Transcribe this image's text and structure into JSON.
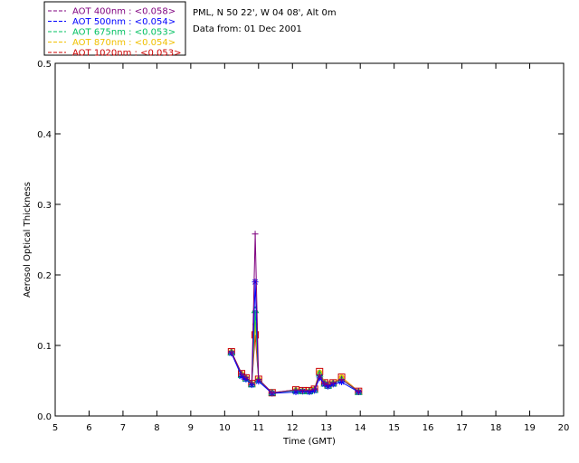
{
  "chart_data": {
    "type": "line",
    "xlabel": "Time (GMT)",
    "ylabel": "Aerosol Optical Thickness",
    "xlim": [
      5,
      20
    ],
    "ylim": [
      0.0,
      0.5
    ],
    "xticks": [
      5,
      6,
      7,
      8,
      9,
      10,
      11,
      12,
      13,
      14,
      15,
      16,
      17,
      18,
      19,
      20
    ],
    "yticks": [
      0.0,
      0.1,
      0.2,
      0.3,
      0.4,
      0.5
    ],
    "ytick_labels": [
      "0.0",
      "0.1",
      "0.2",
      "0.3",
      "0.4",
      "0.5"
    ],
    "grid": false,
    "legend_position": "top-left, outside plot",
    "info_lines": [
      "PML, N 50 22', W 04 08', Alt 0m",
      "Data from: 01 Dec 2001"
    ],
    "series": [
      {
        "name": "AOT  400nm : <0.058>",
        "color": "#7f007f",
        "marker": "plus",
        "points": [
          [
            10.2,
            0.091
          ],
          [
            10.5,
            0.06
          ],
          [
            10.63,
            0.055
          ],
          [
            10.8,
            0.047
          ],
          [
            10.9,
            0.258
          ],
          [
            11.0,
            0.052
          ],
          [
            11.4,
            0.033
          ],
          [
            12.1,
            0.037
          ],
          [
            12.3,
            0.036
          ],
          [
            12.5,
            0.036
          ],
          [
            12.65,
            0.038
          ],
          [
            12.8,
            0.058
          ],
          [
            12.95,
            0.046
          ],
          [
            13.05,
            0.044
          ],
          [
            13.2,
            0.047
          ],
          [
            13.45,
            0.052
          ],
          [
            13.95,
            0.035
          ]
        ]
      },
      {
        "name": "AOT  500nm : <0.054>",
        "color": "#0000ff",
        "marker": "asterisk",
        "points": [
          [
            10.2,
            0.089
          ],
          [
            10.5,
            0.056
          ],
          [
            10.63,
            0.052
          ],
          [
            10.8,
            0.044
          ],
          [
            10.9,
            0.19
          ],
          [
            11.0,
            0.049
          ],
          [
            11.4,
            0.032
          ],
          [
            12.1,
            0.034
          ],
          [
            12.3,
            0.035
          ],
          [
            12.5,
            0.034
          ],
          [
            12.65,
            0.036
          ],
          [
            12.8,
            0.054
          ],
          [
            12.95,
            0.045
          ],
          [
            13.05,
            0.042
          ],
          [
            13.2,
            0.045
          ],
          [
            13.45,
            0.048
          ],
          [
            13.95,
            0.034
          ]
        ]
      },
      {
        "name": "AOT  675nm : <0.053>",
        "color": "#00c060",
        "marker": "triangle",
        "points": [
          [
            10.2,
            0.09
          ],
          [
            10.5,
            0.058
          ],
          [
            10.63,
            0.053
          ],
          [
            10.8,
            0.045
          ],
          [
            10.9,
            0.15
          ],
          [
            11.0,
            0.051
          ],
          [
            11.4,
            0.033
          ],
          [
            12.1,
            0.036
          ],
          [
            12.3,
            0.035
          ],
          [
            12.5,
            0.035
          ],
          [
            12.65,
            0.037
          ],
          [
            12.8,
            0.06
          ],
          [
            12.95,
            0.046
          ],
          [
            13.05,
            0.043
          ],
          [
            13.2,
            0.046
          ],
          [
            13.45,
            0.052
          ],
          [
            13.95,
            0.034
          ]
        ]
      },
      {
        "name": "AOT  870nm : <0.054>",
        "color": "#f0c000",
        "marker": "circle",
        "points": [
          [
            10.2,
            0.091
          ],
          [
            10.5,
            0.06
          ],
          [
            10.63,
            0.054
          ],
          [
            10.8,
            0.046
          ],
          [
            10.9,
            0.13
          ],
          [
            11.0,
            0.052
          ],
          [
            11.4,
            0.033
          ],
          [
            12.1,
            0.037
          ],
          [
            12.3,
            0.036
          ],
          [
            12.5,
            0.036
          ],
          [
            12.65,
            0.038
          ],
          [
            12.8,
            0.062
          ],
          [
            12.95,
            0.047
          ],
          [
            13.05,
            0.044
          ],
          [
            13.2,
            0.047
          ],
          [
            13.45,
            0.055
          ],
          [
            13.95,
            0.035
          ]
        ]
      },
      {
        "name": "AOT 1020nm : <0.053>",
        "color": "#cc0000",
        "marker": "square",
        "points": [
          [
            10.2,
            0.091
          ],
          [
            10.5,
            0.06
          ],
          [
            10.63,
            0.054
          ],
          [
            10.8,
            0.046
          ],
          [
            10.9,
            0.115
          ],
          [
            11.0,
            0.052
          ],
          [
            11.4,
            0.033
          ],
          [
            12.1,
            0.037
          ],
          [
            12.3,
            0.036
          ],
          [
            12.5,
            0.036
          ],
          [
            12.65,
            0.038
          ],
          [
            12.8,
            0.063
          ],
          [
            12.95,
            0.047
          ],
          [
            13.05,
            0.044
          ],
          [
            13.2,
            0.047
          ],
          [
            13.45,
            0.055
          ],
          [
            13.95,
            0.035
          ]
        ]
      }
    ]
  }
}
